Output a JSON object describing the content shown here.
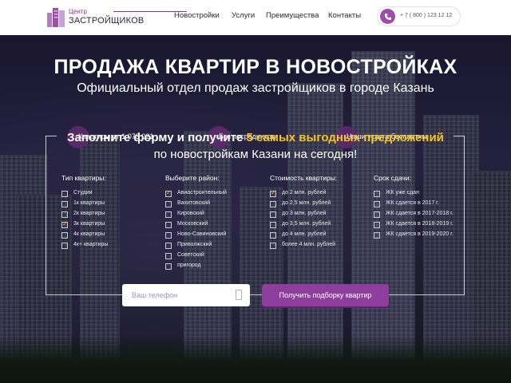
{
  "header": {
    "logo_top": "Центр",
    "logo_bottom": "ЗАСТРОЙЩИКОВ",
    "nav": [
      "Новостройки",
      "Услуги",
      "Преимущества",
      "Контакты"
    ],
    "phone": "+ 7 ( 800 ) 123 12 12"
  },
  "hero": {
    "title": "ПРОДАЖА КВАРТИР В НОВОСТРОЙКАХ",
    "subtitle": "Официальный отдел продаж застройщиков в городе Казань",
    "features": [
      "Квартиры от 1 073 021",
      "Без посредников",
      "Наши услуги бесплатны"
    ]
  },
  "form": {
    "heading_prefix": "Заполните форму и получите ",
    "heading_highlight": "5 самых выгодных предложений",
    "heading_line2": "по новостройкам Казани на сегодня!",
    "columns": [
      {
        "title": "Тип квартиры:",
        "options": [
          {
            "label": "Студии",
            "checked": false
          },
          {
            "label": "1к квартиры",
            "checked": false
          },
          {
            "label": "2к квартиры",
            "checked": false
          },
          {
            "label": "3к квартиры",
            "checked": true
          },
          {
            "label": "4к квартиры",
            "checked": false
          },
          {
            "label": "4к+ квартиры",
            "checked": false
          }
        ]
      },
      {
        "title": "Выберите район:",
        "options": [
          {
            "label": "Авиастроительный",
            "checked": true
          },
          {
            "label": "Вахитовский",
            "checked": false
          },
          {
            "label": "Кировский",
            "checked": false
          },
          {
            "label": "Московский",
            "checked": false
          },
          {
            "label": "Ново-Савиновский",
            "checked": false
          },
          {
            "label": "Приволжский",
            "checked": false
          },
          {
            "label": "Советский",
            "checked": false
          },
          {
            "label": "пригород",
            "checked": false
          }
        ]
      },
      {
        "title": "Стоимость квартиры:",
        "options": [
          {
            "label": "до 2 млн. рублей",
            "checked": true
          },
          {
            "label": "до 2,5 млн. рублей",
            "checked": false
          },
          {
            "label": "до 3 млн. рублей",
            "checked": false
          },
          {
            "label": "до 3,5 млн. рублей",
            "checked": false
          },
          {
            "label": "до 4 млн. рублей",
            "checked": false
          },
          {
            "label": "более 4 млн. рублей",
            "checked": false
          }
        ]
      },
      {
        "title": "Срок сдачи:",
        "options": [
          {
            "label": "ЖК уже сдан",
            "checked": false
          },
          {
            "label": "ЖК сдается в 2017 г.",
            "checked": false
          },
          {
            "label": "ЖК сдается в 2017-2018 г.",
            "checked": false
          },
          {
            "label": "ЖК сдается в 2018-2019 г.",
            "checked": false
          },
          {
            "label": "ЖК сдается в 2019-2020 г.",
            "checked": false
          }
        ]
      }
    ],
    "phone_placeholder": "Ваш телефон",
    "submit_label": "Получить подборку квартир"
  },
  "colors": {
    "accent": "#8e3f9d",
    "highlight": "#f3c623",
    "hero_bg": "#1f1d36"
  }
}
